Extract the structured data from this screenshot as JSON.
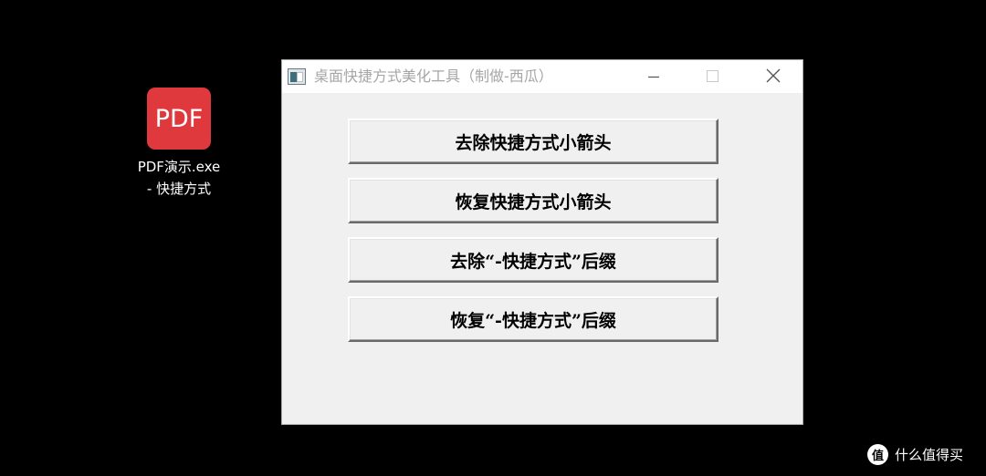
{
  "desktop": {
    "shortcut": {
      "icon_text": "PDF",
      "label_line1": "PDF演示.exe",
      "label_line2": "- 快捷方式",
      "icon_color": "#e0393d"
    }
  },
  "window": {
    "title": "桌面快捷方式美化工具（制做-西瓜）",
    "buttons": [
      {
        "label": "去除快捷方式小箭头"
      },
      {
        "label": "恢复快捷方式小箭头"
      },
      {
        "label": "去除“-快捷方式”后缀"
      },
      {
        "label": "恢复“-快捷方式”后缀"
      }
    ]
  },
  "watermark": {
    "logo_text": "值",
    "text": "什么值得买"
  },
  "colors": {
    "desktop_bg": "#000000",
    "window_bg": "#f0f0f0",
    "titlebar_bg": "#ffffff",
    "title_text": "#a6a6a6"
  }
}
